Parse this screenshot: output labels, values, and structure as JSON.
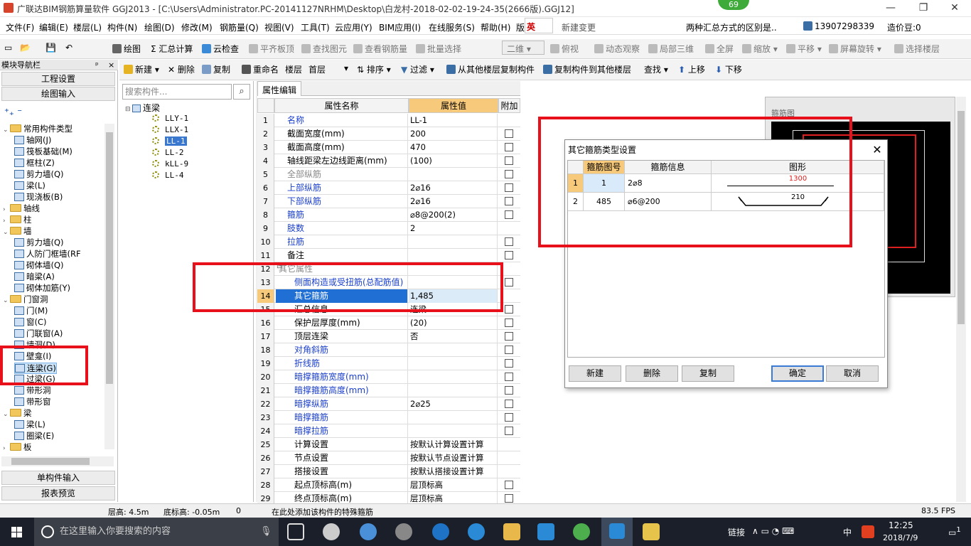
{
  "window": {
    "title": "广联达BIM钢筋算量软件 GGJ2013 - [C:\\Users\\Administrator.PC-20141127NRHM\\Desktop\\白龙村-2018-02-02-19-24-35(2666版).GGJ12]",
    "badge": "69",
    "minimize": "—",
    "restore": "❐",
    "close": "✕"
  },
  "menu": {
    "items": [
      "文件(F)",
      "编辑(E)",
      "楼层(L)",
      "构件(N)",
      "绘图(D)",
      "修改(M)",
      "钢筋量(Q)",
      "视图(V)",
      "工具(T)",
      "云应用(Y)",
      "BIM应用(I)",
      "在线服务(S)",
      "帮助(H)",
      "版本号"
    ],
    "ime": "英",
    "new_change": "新建变更",
    "hint": "两种汇总方式的区别是..",
    "phone": "13907298339",
    "price": "造价豆:0"
  },
  "toolbar1": {
    "draw": "绘图",
    "sum": "汇总计算",
    "cloud_check": "云检查",
    "flat_board": "平齐板顶",
    "find_elem": "查找图元",
    "view_steel": "查看钢筋量",
    "batch_select": "批量选择",
    "view_mode": "二维",
    "top_view": "俯视",
    "dynamic": "动态观察",
    "local3d": "局部三维",
    "fullscreen": "全屏",
    "zoom": "缩放",
    "pan": "平移",
    "rotate": "屏幕旋转",
    "select_floor": "选择楼层"
  },
  "toolbar2": {
    "new": "新建",
    "delete": "删除",
    "copy": "复制",
    "rename": "重命名",
    "floor_label": "楼层",
    "floor_value": "首层",
    "sort": "排序",
    "filter": "过滤",
    "copy_from": "从其他楼层复制构件",
    "copy_to": "复制构件到其他楼层",
    "find": "查找",
    "move_up": "上移",
    "move_down": "下移"
  },
  "nav": {
    "header": "模块导航栏",
    "pin": "ㅁ",
    "close": "×",
    "project_settings": "工程设置",
    "drawing_input": "绘图输入",
    "single_input": "单构件输入",
    "report_preview": "报表预览",
    "tree": [
      {
        "label": "常用构件类型",
        "type": "folder",
        "open": true
      },
      {
        "label": "轴网(J)",
        "type": "item"
      },
      {
        "label": "筏板基础(M)",
        "type": "item"
      },
      {
        "label": "框柱(Z)",
        "type": "item"
      },
      {
        "label": "剪力墙(Q)",
        "type": "item"
      },
      {
        "label": "梁(L)",
        "type": "item"
      },
      {
        "label": "现浇板(B)",
        "type": "item"
      },
      {
        "label": "轴线",
        "type": "folder",
        "open": false
      },
      {
        "label": "柱",
        "type": "folder",
        "open": false
      },
      {
        "label": "墙",
        "type": "folder",
        "open": true
      },
      {
        "label": "剪力墙(Q)",
        "type": "item"
      },
      {
        "label": "人防门框墙(RF",
        "type": "item"
      },
      {
        "label": "砌体墙(Q)",
        "type": "item"
      },
      {
        "label": "暗梁(A)",
        "type": "item"
      },
      {
        "label": "砌体加筋(Y)",
        "type": "item"
      },
      {
        "label": "门窗洞",
        "type": "folder",
        "open": true
      },
      {
        "label": "门(M)",
        "type": "item"
      },
      {
        "label": "窗(C)",
        "type": "item"
      },
      {
        "label": "门联窗(A)",
        "type": "item"
      },
      {
        "label": "墙洞(D)",
        "type": "item"
      },
      {
        "label": "壁龛(I)",
        "type": "item"
      },
      {
        "label": "连梁(G)",
        "type": "item",
        "selected": true
      },
      {
        "label": "过梁(G)",
        "type": "item"
      },
      {
        "label": "带形洞",
        "type": "item"
      },
      {
        "label": "带形窗",
        "type": "item"
      },
      {
        "label": "梁",
        "type": "folder",
        "open": true
      },
      {
        "label": "梁(L)",
        "type": "item"
      },
      {
        "label": "圈梁(E)",
        "type": "item"
      },
      {
        "label": "板",
        "type": "folder",
        "open": false
      }
    ]
  },
  "components": {
    "search_placeholder": "搜索构件...",
    "root": "连梁",
    "items": [
      "LLY-1",
      "LLX-1",
      "LL-1",
      "LL-2",
      "kLL-9",
      "LL-4"
    ],
    "selected": "LL-1"
  },
  "props": {
    "tab": "属性编辑",
    "col_name": "属性名称",
    "col_value": "属性值",
    "col_extra": "附加",
    "rows": [
      {
        "n": "1",
        "name": "名称",
        "value": "LL-1",
        "style": "blue",
        "check": false
      },
      {
        "n": "2",
        "name": "截面宽度(mm)",
        "value": "200",
        "style": "",
        "check": true
      },
      {
        "n": "3",
        "name": "截面高度(mm)",
        "value": "470",
        "style": "",
        "check": true
      },
      {
        "n": "4",
        "name": "轴线距梁左边线距离(mm)",
        "value": "(100)",
        "style": "",
        "check": true
      },
      {
        "n": "5",
        "name": "全部纵筋",
        "value": "",
        "style": "gray",
        "check": true
      },
      {
        "n": "6",
        "name": "上部纵筋",
        "value": "2⌀16",
        "style": "blue",
        "check": true
      },
      {
        "n": "7",
        "name": "下部纵筋",
        "value": "2⌀16",
        "style": "blue",
        "check": true
      },
      {
        "n": "8",
        "name": "箍筋",
        "value": "⌀8@200(2)",
        "style": "blue",
        "check": true
      },
      {
        "n": "9",
        "name": "肢数",
        "value": "2",
        "style": "blue",
        "check": false
      },
      {
        "n": "10",
        "name": "拉筋",
        "value": "",
        "style": "blue",
        "check": true
      },
      {
        "n": "11",
        "name": "备注",
        "value": "",
        "style": "",
        "check": true
      },
      {
        "n": "12",
        "name": "其它属性",
        "value": "",
        "style": "group",
        "check": false
      },
      {
        "n": "13",
        "name": "侧面构造或受扭筋(总配筋值)",
        "value": "",
        "style": "blue2",
        "check": true
      },
      {
        "n": "14",
        "name": "其它箍筋",
        "value": "1,485",
        "style": "selected",
        "check": false
      },
      {
        "n": "15",
        "name": "汇总信息",
        "value": "连梁",
        "style": "sub",
        "check": true
      },
      {
        "n": "16",
        "name": "保护层厚度(mm)",
        "value": "(20)",
        "style": "sub",
        "check": true
      },
      {
        "n": "17",
        "name": "顶层连梁",
        "value": "否",
        "style": "sub",
        "check": true
      },
      {
        "n": "18",
        "name": "对角斜筋",
        "value": "",
        "style": "bluesub",
        "check": true
      },
      {
        "n": "19",
        "name": "折线筋",
        "value": "",
        "style": "bluesub",
        "check": true
      },
      {
        "n": "20",
        "name": "暗撑箍筋宽度(mm)",
        "value": "",
        "style": "bluesub",
        "check": true
      },
      {
        "n": "21",
        "name": "暗撑箍筋高度(mm)",
        "value": "",
        "style": "bluesub",
        "check": true
      },
      {
        "n": "22",
        "name": "暗撑纵筋",
        "value": "2⌀25",
        "style": "bluesub",
        "check": true
      },
      {
        "n": "23",
        "name": "暗撑箍筋",
        "value": "",
        "style": "bluesub",
        "check": true
      },
      {
        "n": "24",
        "name": "暗撑拉筋",
        "value": "",
        "style": "bluesub",
        "check": true
      },
      {
        "n": "25",
        "name": "计算设置",
        "value": "按默认计算设置计算",
        "style": "sub",
        "check": false
      },
      {
        "n": "26",
        "name": "节点设置",
        "value": "按默认节点设置计算",
        "style": "sub",
        "check": false
      },
      {
        "n": "27",
        "name": "搭接设置",
        "value": "按默认搭接设置计算",
        "style": "sub",
        "check": false
      },
      {
        "n": "28",
        "name": "起点顶标高(m)",
        "value": "层顶标高",
        "style": "sub",
        "check": true
      },
      {
        "n": "29",
        "name": "终点顶标高(m)",
        "value": "层顶标高",
        "style": "sub",
        "check": true
      }
    ]
  },
  "stirrup_panel": {
    "label": "箍筋图"
  },
  "dialog": {
    "title": "其它箍筋类型设置",
    "close": "✕",
    "col_no": "箍筋图号",
    "col_info": "箍筋信息",
    "col_shape": "图形",
    "rows": [
      {
        "n": "1",
        "no": "1",
        "info": "2⌀8",
        "shape_val": "1300"
      },
      {
        "n": "2",
        "no": "485",
        "info": "⌀6@200",
        "shape_val": "210"
      }
    ],
    "btn_new": "新建",
    "btn_delete": "删除",
    "btn_copy": "复制",
    "btn_ok": "确定",
    "btn_cancel": "取消"
  },
  "status": {
    "floor_height": "层高: 4.5m",
    "base_elev": "底标高: -0.05m",
    "zero": "0",
    "message": "在此处添加该构件的特殊箍筋",
    "fps": "83.5 FPS"
  },
  "taskbar": {
    "search": "在这里输入你要搜索的内容",
    "link": "链接",
    "lang": "中",
    "time": "12:25",
    "date": "2018/7/9",
    "notify": "1"
  }
}
